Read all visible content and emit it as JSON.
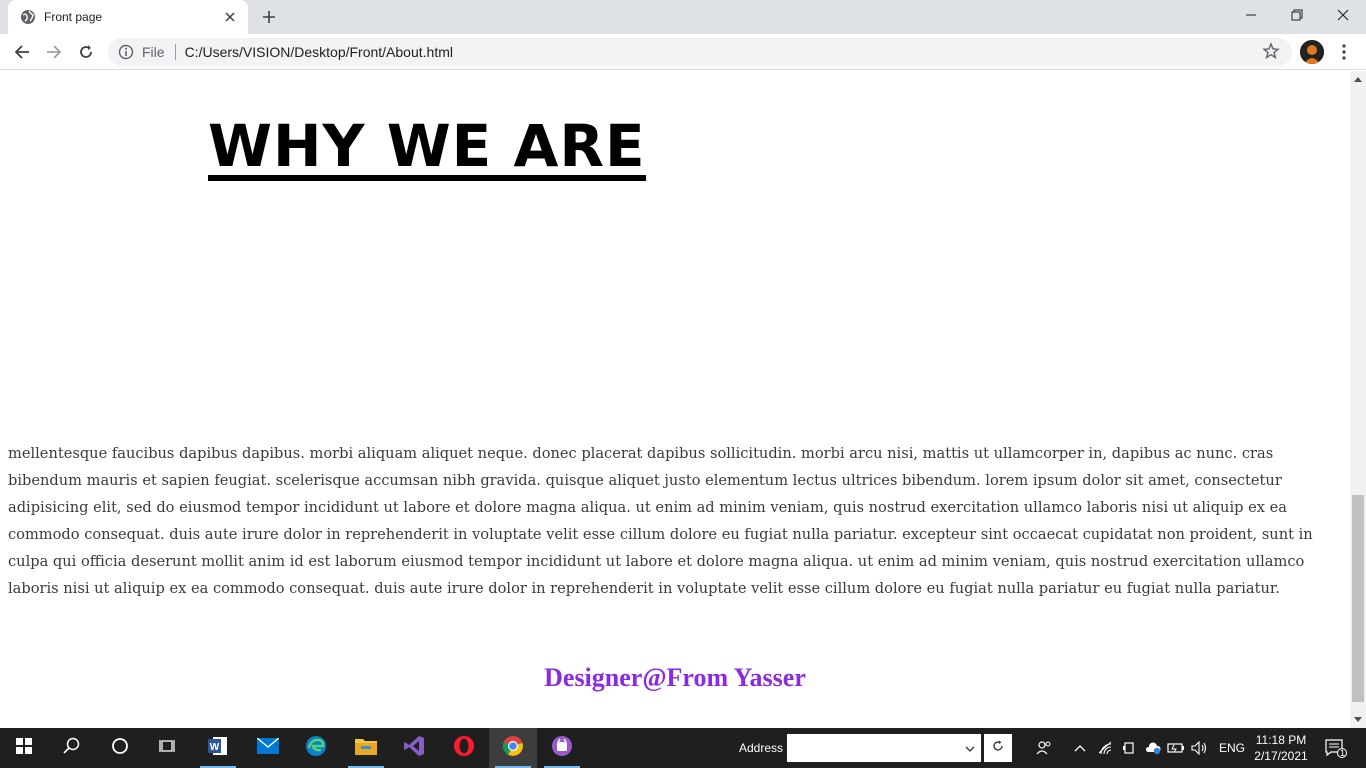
{
  "browser": {
    "tab_title": "Front page",
    "url_scheme": "File",
    "url": "C:/Users/VISION/Desktop/Front/About.html"
  },
  "page": {
    "heading": "WHY WE ARE",
    "paragraph": "mellentesque faucibus dapibus dapibus. morbi aliquam aliquet neque. donec placerat dapibus sollicitudin. morbi arcu nisi, mattis ut ullamcorper in, dapibus ac nunc. cras bibendum mauris et sapien feugiat. scelerisque accumsan nibh gravida. quisque aliquet justo elementum lectus ultrices bibendum. lorem ipsum dolor sit amet, consectetur adipisicing elit, sed do eiusmod tempor incididunt ut labore et dolore magna aliqua. ut enim ad minim veniam, quis nostrud exercitation ullamco laboris nisi ut aliquip ex ea commodo consequat. duis aute irure dolor in reprehenderit in voluptate velit esse cillum dolore eu fugiat nulla pariatur. excepteur sint occaecat cupidatat non proident, sunt in culpa qui officia deserunt mollit anim id est laborum eiusmod tempor incididunt ut labore et dolore magna aliqua. ut enim ad minim veniam, quis nostrud exercitation ullamco laboris nisi ut aliquip ex ea commodo consequat. duis aute irure dolor in reprehenderit in voluptate velit esse cillum dolore eu fugiat nulla pariatur eu fugiat nulla pariatur.",
    "signature": "Designer@From Yasser",
    "signature_color": "#8a2be2"
  },
  "taskbar": {
    "address_label": "Address",
    "address_value": "",
    "language": "ENG",
    "time": "11:18 PM",
    "date": "2/17/2021",
    "notification_count": "1",
    "pinned_apps": [
      "start-icon",
      "search-icon",
      "cortana-icon",
      "task-view-icon",
      "word-icon",
      "mail-icon",
      "edge-icon",
      "file-explorer-icon",
      "visual-studio-icon",
      "opera-icon",
      "chrome-icon",
      "app-icon"
    ]
  }
}
